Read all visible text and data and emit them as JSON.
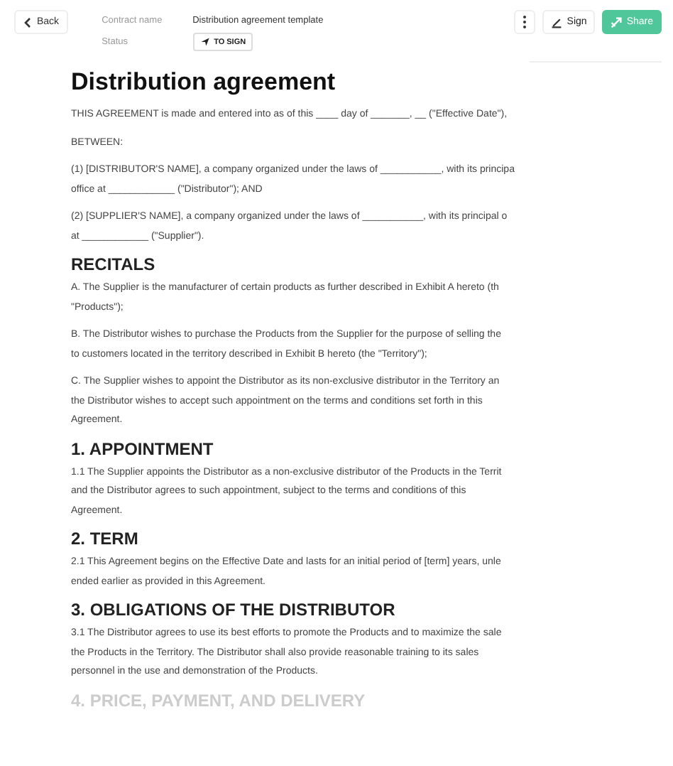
{
  "header": {
    "back": "Back",
    "fields": [
      {
        "label": "Contract name",
        "value": "Distribution agreement template",
        "kind": "text"
      },
      {
        "label": "Status",
        "value": "TO SIGN",
        "kind": "badge"
      }
    ],
    "actions": [
      {
        "label": "Sign",
        "kind": "sign"
      },
      {
        "label": "Share",
        "kind": "share"
      }
    ]
  },
  "document": {
    "title": "Distribution agreement",
    "blocks": [
      {
        "kind": "paragraph",
        "lines": [
          "THIS AGREEMENT is made and entered into as of this ____ day of _______, __ (\"Effective Date\"),"
        ]
      },
      {
        "kind": "paragraph",
        "lines": [
          "BETWEEN:"
        ]
      },
      {
        "kind": "paragraph",
        "lines": [
          "(1) [DISTRIBUTOR'S NAME], a company organized under the laws of ___________, with its principa",
          "office at ____________ (\"Distributor\"); AND"
        ]
      },
      {
        "kind": "paragraph",
        "lines": [
          "(2) [SUPPLIER'S NAME], a company organized under the laws of ___________, with its principal o",
          "at ____________ (\"Supplier\")."
        ]
      },
      {
        "kind": "heading",
        "lines": [
          "RECITALS"
        ],
        "faded": false
      },
      {
        "kind": "paragraph",
        "lines": [
          "A. The Supplier is the manufacturer of certain products as further described in Exhibit A hereto (th",
          "\"Products\");"
        ]
      },
      {
        "kind": "paragraph",
        "lines": [
          "B. The Distributor wishes to purchase the Products from the Supplier for the purpose of selling the",
          "to customers located in the territory described in Exhibit B hereto (the \"Territory\");"
        ]
      },
      {
        "kind": "paragraph",
        "lines": [
          "C. The Supplier wishes to appoint the Distributor as its non-exclusive distributor in the Territory an",
          "the Distributor wishes to accept such appointment on the terms and conditions set forth in this",
          "Agreement."
        ]
      },
      {
        "kind": "heading",
        "lines": [
          "1. APPOINTMENT"
        ],
        "faded": false
      },
      {
        "kind": "paragraph",
        "lines": [
          "1.1 The Supplier appoints the Distributor as a non-exclusive distributor of the Products in the Territ",
          "and the Distributor agrees to such appointment, subject to the terms and conditions of this",
          "Agreement."
        ]
      },
      {
        "kind": "heading",
        "lines": [
          "2. TERM"
        ],
        "faded": false
      },
      {
        "kind": "paragraph",
        "lines": [
          "2.1 This Agreement begins on the Effective Date and lasts for an initial period of [term] years, unle",
          "ended earlier as provided in this Agreement."
        ]
      },
      {
        "kind": "heading",
        "lines": [
          "3. OBLIGATIONS OF THE DISTRIBUTOR"
        ],
        "faded": false
      },
      {
        "kind": "paragraph",
        "lines": [
          "3.1 The Distributor agrees to use its best efforts to promote the Products and to maximize the sale",
          "the Products in the Territory. The Distributor shall also provide reasonable training to its sales",
          "personnel in the use and demonstration of the Products."
        ]
      },
      {
        "kind": "heading",
        "lines": [
          "4. PRICE, PAYMENT, AND DELIVERY"
        ],
        "faded": true
      }
    ]
  }
}
